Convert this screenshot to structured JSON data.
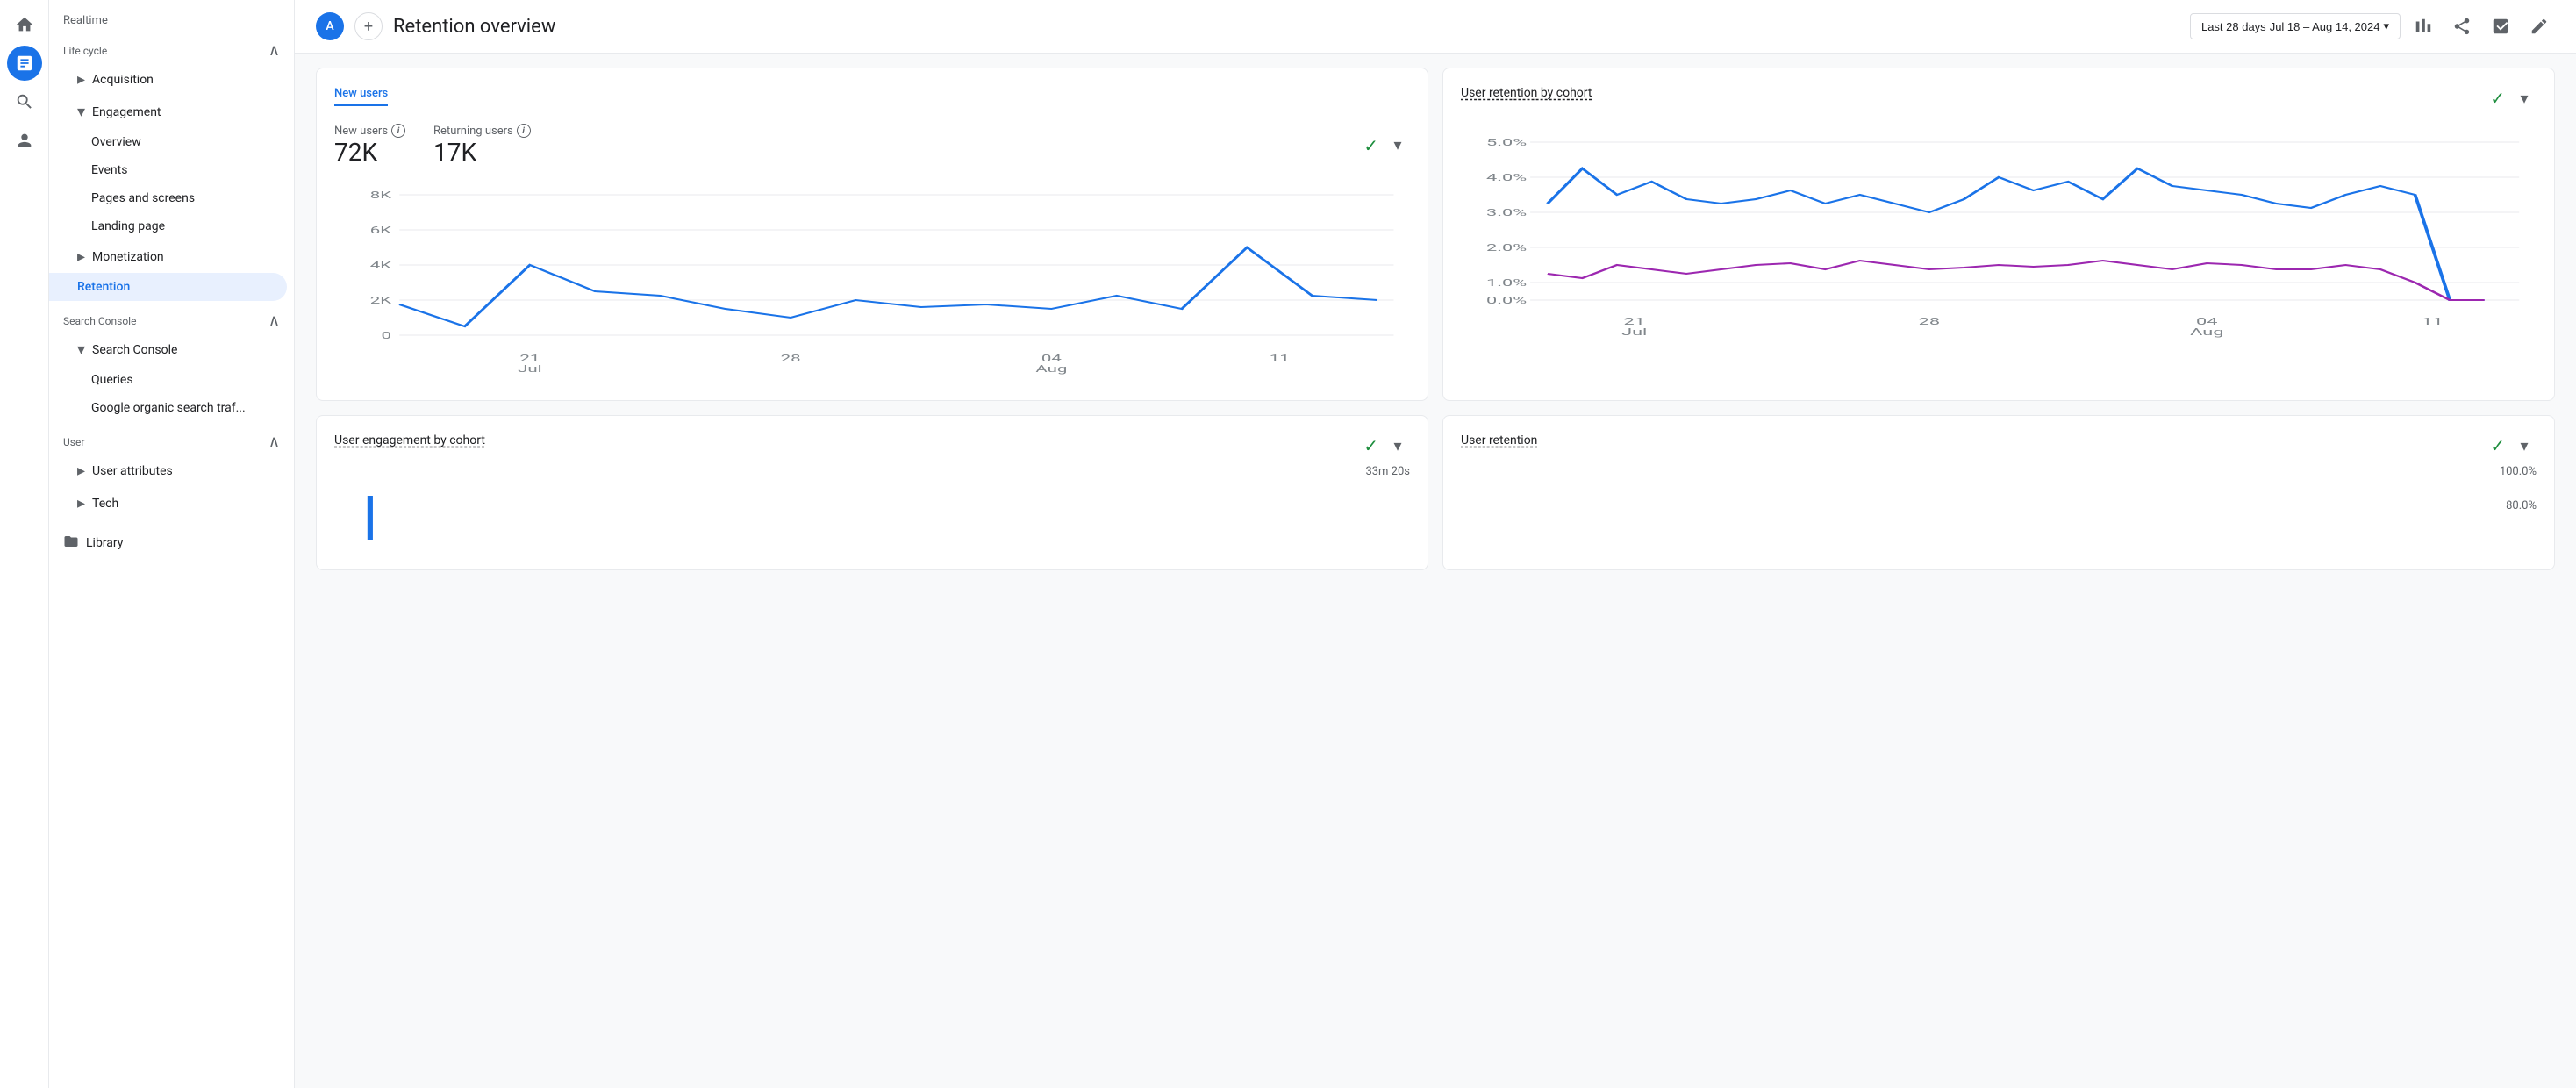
{
  "iconRail": {
    "homeIcon": "⌂",
    "analyticsIcon": "▦",
    "searchIcon": "🔍",
    "audienceIcon": "👤"
  },
  "sidebar": {
    "realtimeLabel": "Realtime",
    "sections": [
      {
        "name": "lifecycle",
        "label": "Life cycle",
        "expanded": true,
        "items": [
          {
            "id": "acquisition",
            "label": "Acquisition",
            "indent": 1,
            "expandable": true,
            "active": false
          },
          {
            "id": "engagement",
            "label": "Engagement",
            "indent": 1,
            "expandable": true,
            "active": false,
            "expanded": true
          },
          {
            "id": "overview",
            "label": "Overview",
            "indent": 2,
            "active": false
          },
          {
            "id": "events",
            "label": "Events",
            "indent": 2,
            "active": false
          },
          {
            "id": "pages-and-screens",
            "label": "Pages and screens",
            "indent": 2,
            "active": false
          },
          {
            "id": "landing-page",
            "label": "Landing page",
            "indent": 2,
            "active": false
          },
          {
            "id": "monetization",
            "label": "Monetization",
            "indent": 1,
            "expandable": true,
            "active": false
          },
          {
            "id": "retention",
            "label": "Retention",
            "indent": 1,
            "active": true
          }
        ]
      },
      {
        "name": "search-console",
        "label": "Search Console",
        "expanded": true,
        "items": [
          {
            "id": "search-console-parent",
            "label": "Search Console",
            "indent": 1,
            "expandable": true,
            "active": false,
            "expanded": true
          },
          {
            "id": "queries",
            "label": "Queries",
            "indent": 2,
            "active": false
          },
          {
            "id": "google-organic",
            "label": "Google organic search traf...",
            "indent": 2,
            "active": false
          }
        ]
      },
      {
        "name": "user",
        "label": "User",
        "expanded": true,
        "items": [
          {
            "id": "user-attributes",
            "label": "User attributes",
            "indent": 1,
            "expandable": true,
            "active": false
          },
          {
            "id": "tech",
            "label": "Tech",
            "indent": 1,
            "expandable": true,
            "active": false
          }
        ]
      }
    ],
    "libraryLabel": "Library"
  },
  "header": {
    "avatarLetter": "A",
    "addButtonLabel": "+",
    "title": "Retention overview",
    "dateRangePrefix": "Last 28 days",
    "dateRange": "Jul 18 – Aug 14, 2024",
    "compareIcon": "⊞",
    "shareIcon": "↗",
    "insightIcon": "✦",
    "editIcon": "✏"
  },
  "mainChart": {
    "newUsersLabel": "New users",
    "returningUsersLabel": "Returning users",
    "newUsersValue": "72K",
    "returningUsersValue": "17K",
    "yAxisLabels": [
      "8K",
      "6K",
      "4K",
      "2K",
      "0"
    ],
    "xAxisLabels": [
      {
        "label": "21",
        "sublabel": "Jul"
      },
      {
        "label": "28",
        "sublabel": ""
      },
      {
        "label": "04",
        "sublabel": "Aug"
      },
      {
        "label": "11",
        "sublabel": ""
      }
    ]
  },
  "cohortChart": {
    "title": "User retention by cohort",
    "yAxisLabels": [
      "5.0%",
      "4.0%",
      "3.0%",
      "2.0%",
      "1.0%",
      "0.0%"
    ],
    "xAxisLabels": [
      {
        "label": "21",
        "sublabel": "Jul"
      },
      {
        "label": "28",
        "sublabel": ""
      },
      {
        "label": "04",
        "sublabel": "Aug"
      },
      {
        "label": "11",
        "sublabel": ""
      }
    ]
  },
  "engagementCard": {
    "title": "User engagement by cohort",
    "statValue": "33m 20s"
  },
  "retentionCard": {
    "title": "User retention",
    "statValue": "100.0%",
    "statValue2": "80.0%"
  },
  "colors": {
    "primary": "#1a73e8",
    "purple": "#9c27b0",
    "green": "#1e8e3e",
    "activeNavBg": "#e8f0fe",
    "activeNavText": "#1a73e8"
  }
}
